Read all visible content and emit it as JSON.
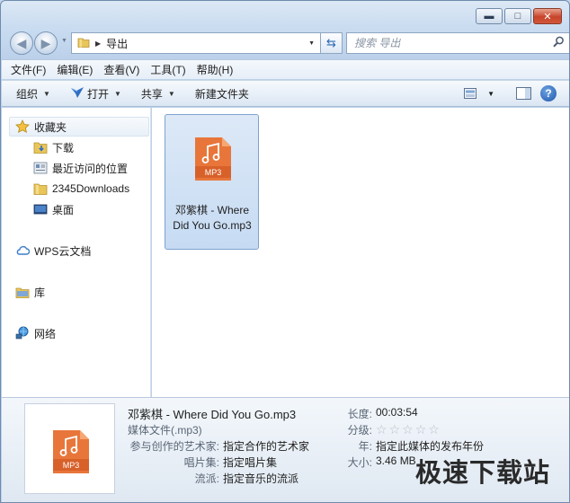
{
  "window": {
    "caption_buttons": {
      "minimize": "▬",
      "maximize": "□",
      "close": "✕"
    }
  },
  "nav": {
    "back_icon": "back-arrow-icon",
    "forward_icon": "forward-arrow-icon",
    "address_crumb": "导出",
    "search_placeholder": "搜索 导出"
  },
  "menu": [
    "文件(F)",
    "编辑(E)",
    "查看(V)",
    "工具(T)",
    "帮助(H)"
  ],
  "toolbar": {
    "organize": "组织",
    "open": "打开",
    "share": "共享",
    "new_folder": "新建文件夹",
    "help": "?"
  },
  "sidebar": {
    "favorites": "收藏夹",
    "fav_items": [
      "下载",
      "最近访问的位置",
      "2345Downloads",
      "桌面"
    ],
    "wps": "WPS云文档",
    "library": "库",
    "network": "网络"
  },
  "file": {
    "name": "邓紫棋 - Where Did You Go.mp3",
    "badge": "MP3"
  },
  "details": {
    "title": "邓紫棋 - Where Did You Go.mp3",
    "type": "媒体文件(.mp3)",
    "artist_label": "参与创作的艺术家:",
    "artist_value": "指定合作的艺术家",
    "album_label": "唱片集:",
    "album_value": "指定唱片集",
    "genre_label": "流派:",
    "genre_value": "指定音乐的流派",
    "length_label": "长度:",
    "length_value": "00:03:54",
    "rating_label": "分级:",
    "rating_stars": 0,
    "year_label": "年:",
    "year_value": "指定此媒体的发布年份",
    "size_label": "大小:",
    "size_value": "3.46 MB"
  },
  "watermark": "极速下载站",
  "colors": {
    "accent": "#e8763a",
    "selection": "#cde0f5",
    "link_blue": "#2d66b3"
  }
}
